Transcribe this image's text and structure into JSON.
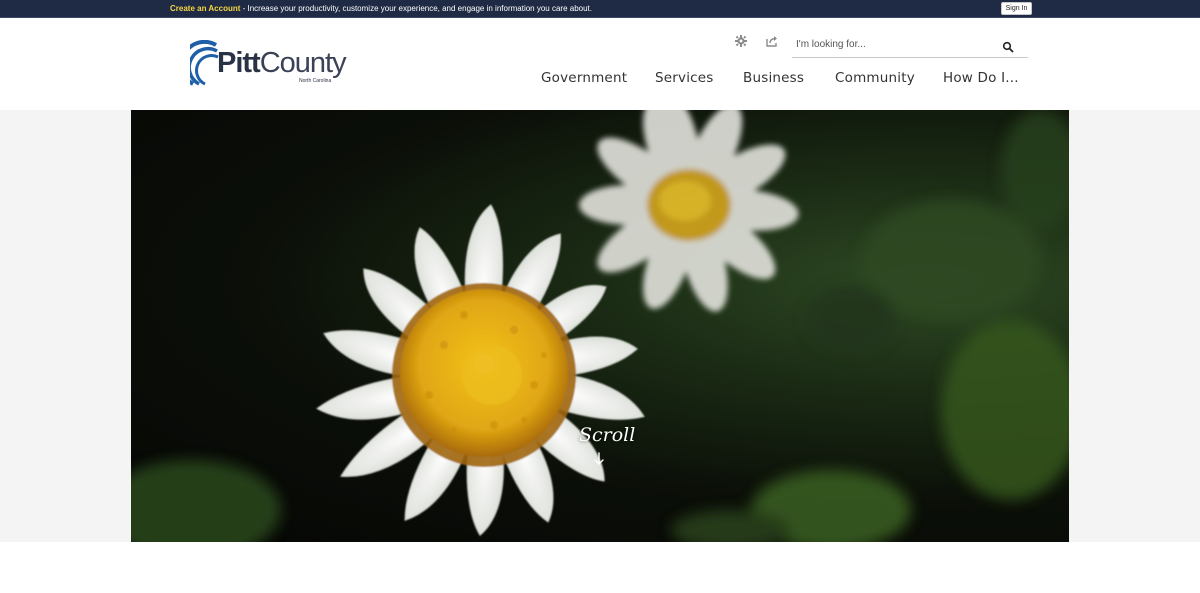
{
  "topbar": {
    "create_account_link": "Create an Account",
    "message": " - Increase your productivity, customize your experience, and engage in information you care about.",
    "sign_in_label": "Sign In"
  },
  "logo": {
    "name_bold": "Pitt",
    "name_rest": "County",
    "state": "North Carolina"
  },
  "tools": {
    "gear_icon": "gear-icon",
    "share_icon": "share-icon"
  },
  "search": {
    "placeholder": "I'm looking for...",
    "value": "",
    "icon": "search-icon"
  },
  "nav": {
    "items": [
      {
        "label": "Government"
      },
      {
        "label": "Services"
      },
      {
        "label": "Business"
      },
      {
        "label": "Community"
      },
      {
        "label": "How Do I..."
      }
    ]
  },
  "hero": {
    "scroll_label": "Scroll",
    "colors": {
      "petal": "#ffffff",
      "center": "#e8b414",
      "foliage": "#2f4a24"
    }
  },
  "colors": {
    "topbar_bg": "#1f2a44",
    "link_accent": "#f5d742",
    "logo_blue": "#1f5fa8",
    "text_dark": "#333333"
  }
}
